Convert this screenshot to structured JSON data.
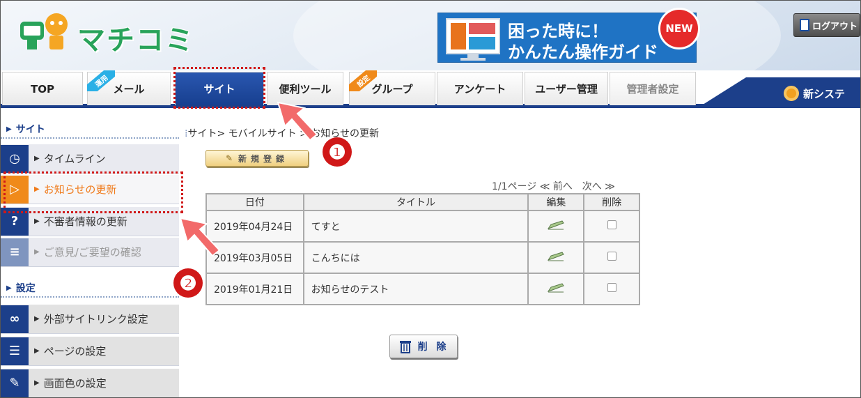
{
  "header": {
    "logo_text": "マチコミ",
    "banner_line1": "困った時に！",
    "banner_line2": "かんたん操作ガイド",
    "banner_badge": "NEW",
    "logout_label": "ログアウト"
  },
  "nav": {
    "tabs": [
      {
        "label": "TOP"
      },
      {
        "label": "メール",
        "ribbon": "運用"
      },
      {
        "label": "サイト"
      },
      {
        "label": "便利ツール"
      },
      {
        "label": "グループ",
        "ribbon": "設定"
      },
      {
        "label": "アンケート"
      },
      {
        "label": "ユーザー管理"
      },
      {
        "label": "管理者設定"
      }
    ],
    "right_text": "新システ"
  },
  "sidebar": {
    "section1": "サイト",
    "items1": [
      {
        "label": "タイムライン"
      },
      {
        "label": "お知らせの更新"
      },
      {
        "label": "不審者情報の更新"
      },
      {
        "label": "ご意見/ご要望の確認"
      }
    ],
    "section2": "設定",
    "items2": [
      {
        "label": "外部サイトリンク設定"
      },
      {
        "label": "ページの設定"
      },
      {
        "label": "画面色の設定"
      }
    ]
  },
  "main": {
    "breadcrumb": "サイト> モバイルサイト > お知らせの更新",
    "new_button": "新規登録",
    "pager": "1/1ページ ≪ 前へ　次へ ≫",
    "table_headers": [
      "日付",
      "タイトル",
      "編集",
      "削除"
    ],
    "rows": [
      {
        "date": "2019年04月24日",
        "title": "てすと"
      },
      {
        "date": "2019年03月05日",
        "title": "こんちには"
      },
      {
        "date": "2019年01月21日",
        "title": "お知らせのテスト"
      }
    ],
    "delete_button": "削 除"
  },
  "annotations": {
    "badge1": "❶",
    "badge2": "❷"
  },
  "colors": {
    "nav_active": "#1c3f8a",
    "sidebar_current": "#f07a1a",
    "annotation": "#d01818",
    "logo": "#28a35a"
  }
}
